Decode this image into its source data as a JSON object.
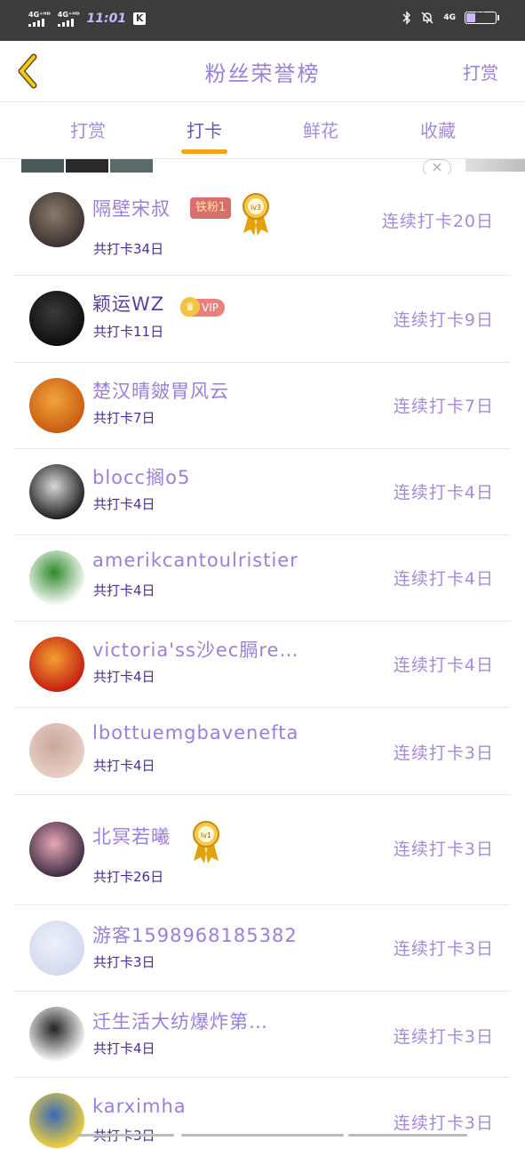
{
  "status_bar": {
    "signal1": "4G⁺ᴴᴰ",
    "signal2": "4G⁺ᴴᴰ",
    "time": "11:01",
    "k_icon": "K",
    "net": "4G",
    "battery": "29",
    "battery_level": 0.29
  },
  "header": {
    "back_icon": "chevron-left-icon",
    "title": "粉丝荣誉榜",
    "right_action": "打赏"
  },
  "tabs": [
    {
      "label": "打赏",
      "active": false
    },
    {
      "label": "打卡",
      "active": true
    },
    {
      "label": "鲜花",
      "active": false
    },
    {
      "label": "收藏",
      "active": false
    }
  ],
  "ad": {
    "close_icon": "×"
  },
  "rows": [
    {
      "name": "隔壁宋叔",
      "total": "共打卡34日",
      "streak": "连续打卡20日",
      "fan_badge": "铁粉1",
      "medal": "lv3",
      "avatar_colors": [
        "#3a3030",
        "#8a7a6a"
      ]
    },
    {
      "name": "颖运WZ",
      "total": "共打卡11日",
      "streak": "连续打卡9日",
      "vip": "VIP",
      "vip_icon": "♛",
      "avatar_colors": [
        "#0d0d0d",
        "#3a3a3a"
      ]
    },
    {
      "name": "楚汉晴皴胃风云",
      "total": "共打卡7日",
      "streak": "连续打卡7日",
      "avatar_colors": [
        "#c75a10",
        "#f3a43c"
      ]
    },
    {
      "name": "blocc搁o5",
      "total": "共打卡4日",
      "streak": "连续打卡4日",
      "avatar_colors": [
        "#1a1a1a",
        "#d8d8d8"
      ]
    },
    {
      "name": "amerikcantoulristier",
      "total": "共打卡4日",
      "streak": "连续打卡4日",
      "avatar_colors": [
        "#ffffff",
        "#2f8a2a"
      ]
    },
    {
      "name": "victoria'ss沙ec膈re…",
      "total": "共打卡4日",
      "streak": "连续打卡4日",
      "avatar_colors": [
        "#c21c10",
        "#f3a030"
      ]
    },
    {
      "name": "lbottuemgbavenefta",
      "total": "共打卡4日",
      "streak": "连续打卡3日",
      "avatar_colors": [
        "#e8d0c8",
        "#caa89a"
      ]
    },
    {
      "name": "北冥若曦",
      "total": "共打卡26日",
      "streak": "连续打卡3日",
      "medal": "lv1",
      "avatar_colors": [
        "#3a2a40",
        "#e8a8b8"
      ]
    },
    {
      "name": "游客1598968185382",
      "total": "共打卡3日",
      "streak": "连续打卡3日",
      "avatar_colors": [
        "#d2d9ee",
        "#eef1fa"
      ]
    },
    {
      "name": "迁生活大纺爆炸第…",
      "total": "共打卡4日",
      "streak": "连续打卡3日",
      "avatar_colors": [
        "#ffffff",
        "#222222"
      ]
    },
    {
      "name": "karximha",
      "total": "共打卡3日",
      "streak": "连续打卡3日",
      "avatar_colors": [
        "#f3d23a",
        "#3a6ab8"
      ]
    }
  ]
}
